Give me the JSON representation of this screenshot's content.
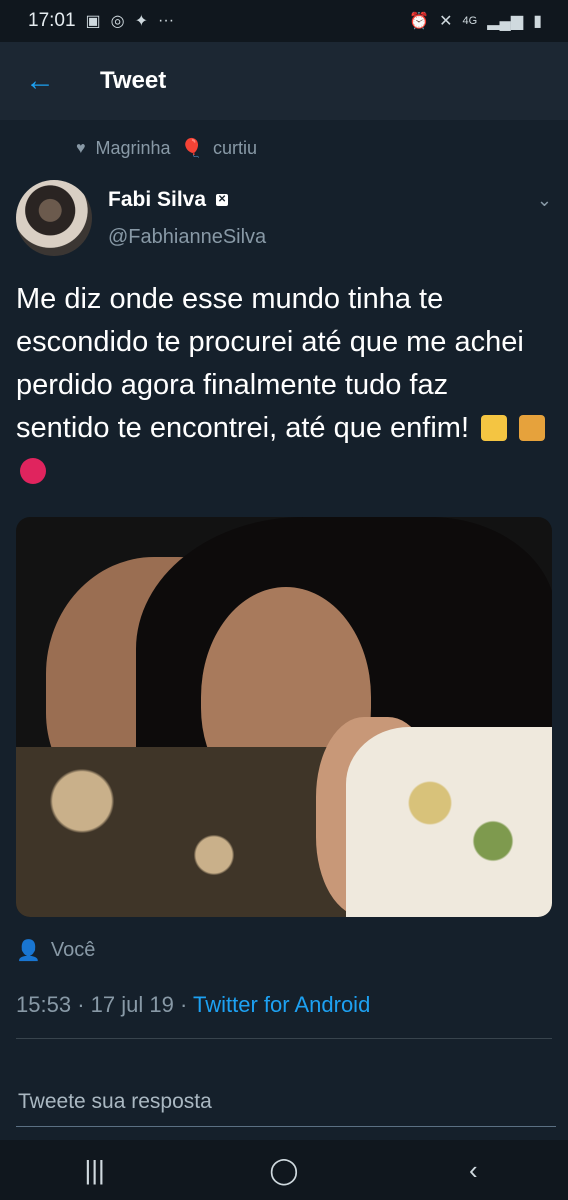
{
  "status": {
    "time": "17:01",
    "network": "4G"
  },
  "appbar": {
    "title": "Tweet"
  },
  "social_context": {
    "user": "Magrinha",
    "emoji": "🎈",
    "action": "curtiu"
  },
  "tweet": {
    "name": "Fabi Silva",
    "handle": "@FabhianneSilva",
    "text": "Me diz onde esse mundo tinha te escondido te procurei até que me achei perdido agora finalmente tudo faz sentido te encontrei, até que enfim!",
    "audience": "Você",
    "time": "15:53",
    "date": "17 jul 19",
    "source": "Twitter for Android"
  },
  "reply": {
    "placeholder": "Tweete sua resposta"
  },
  "colors": {
    "accent": "#1da1f2",
    "background": "#15202b",
    "muted": "#8899a6"
  }
}
